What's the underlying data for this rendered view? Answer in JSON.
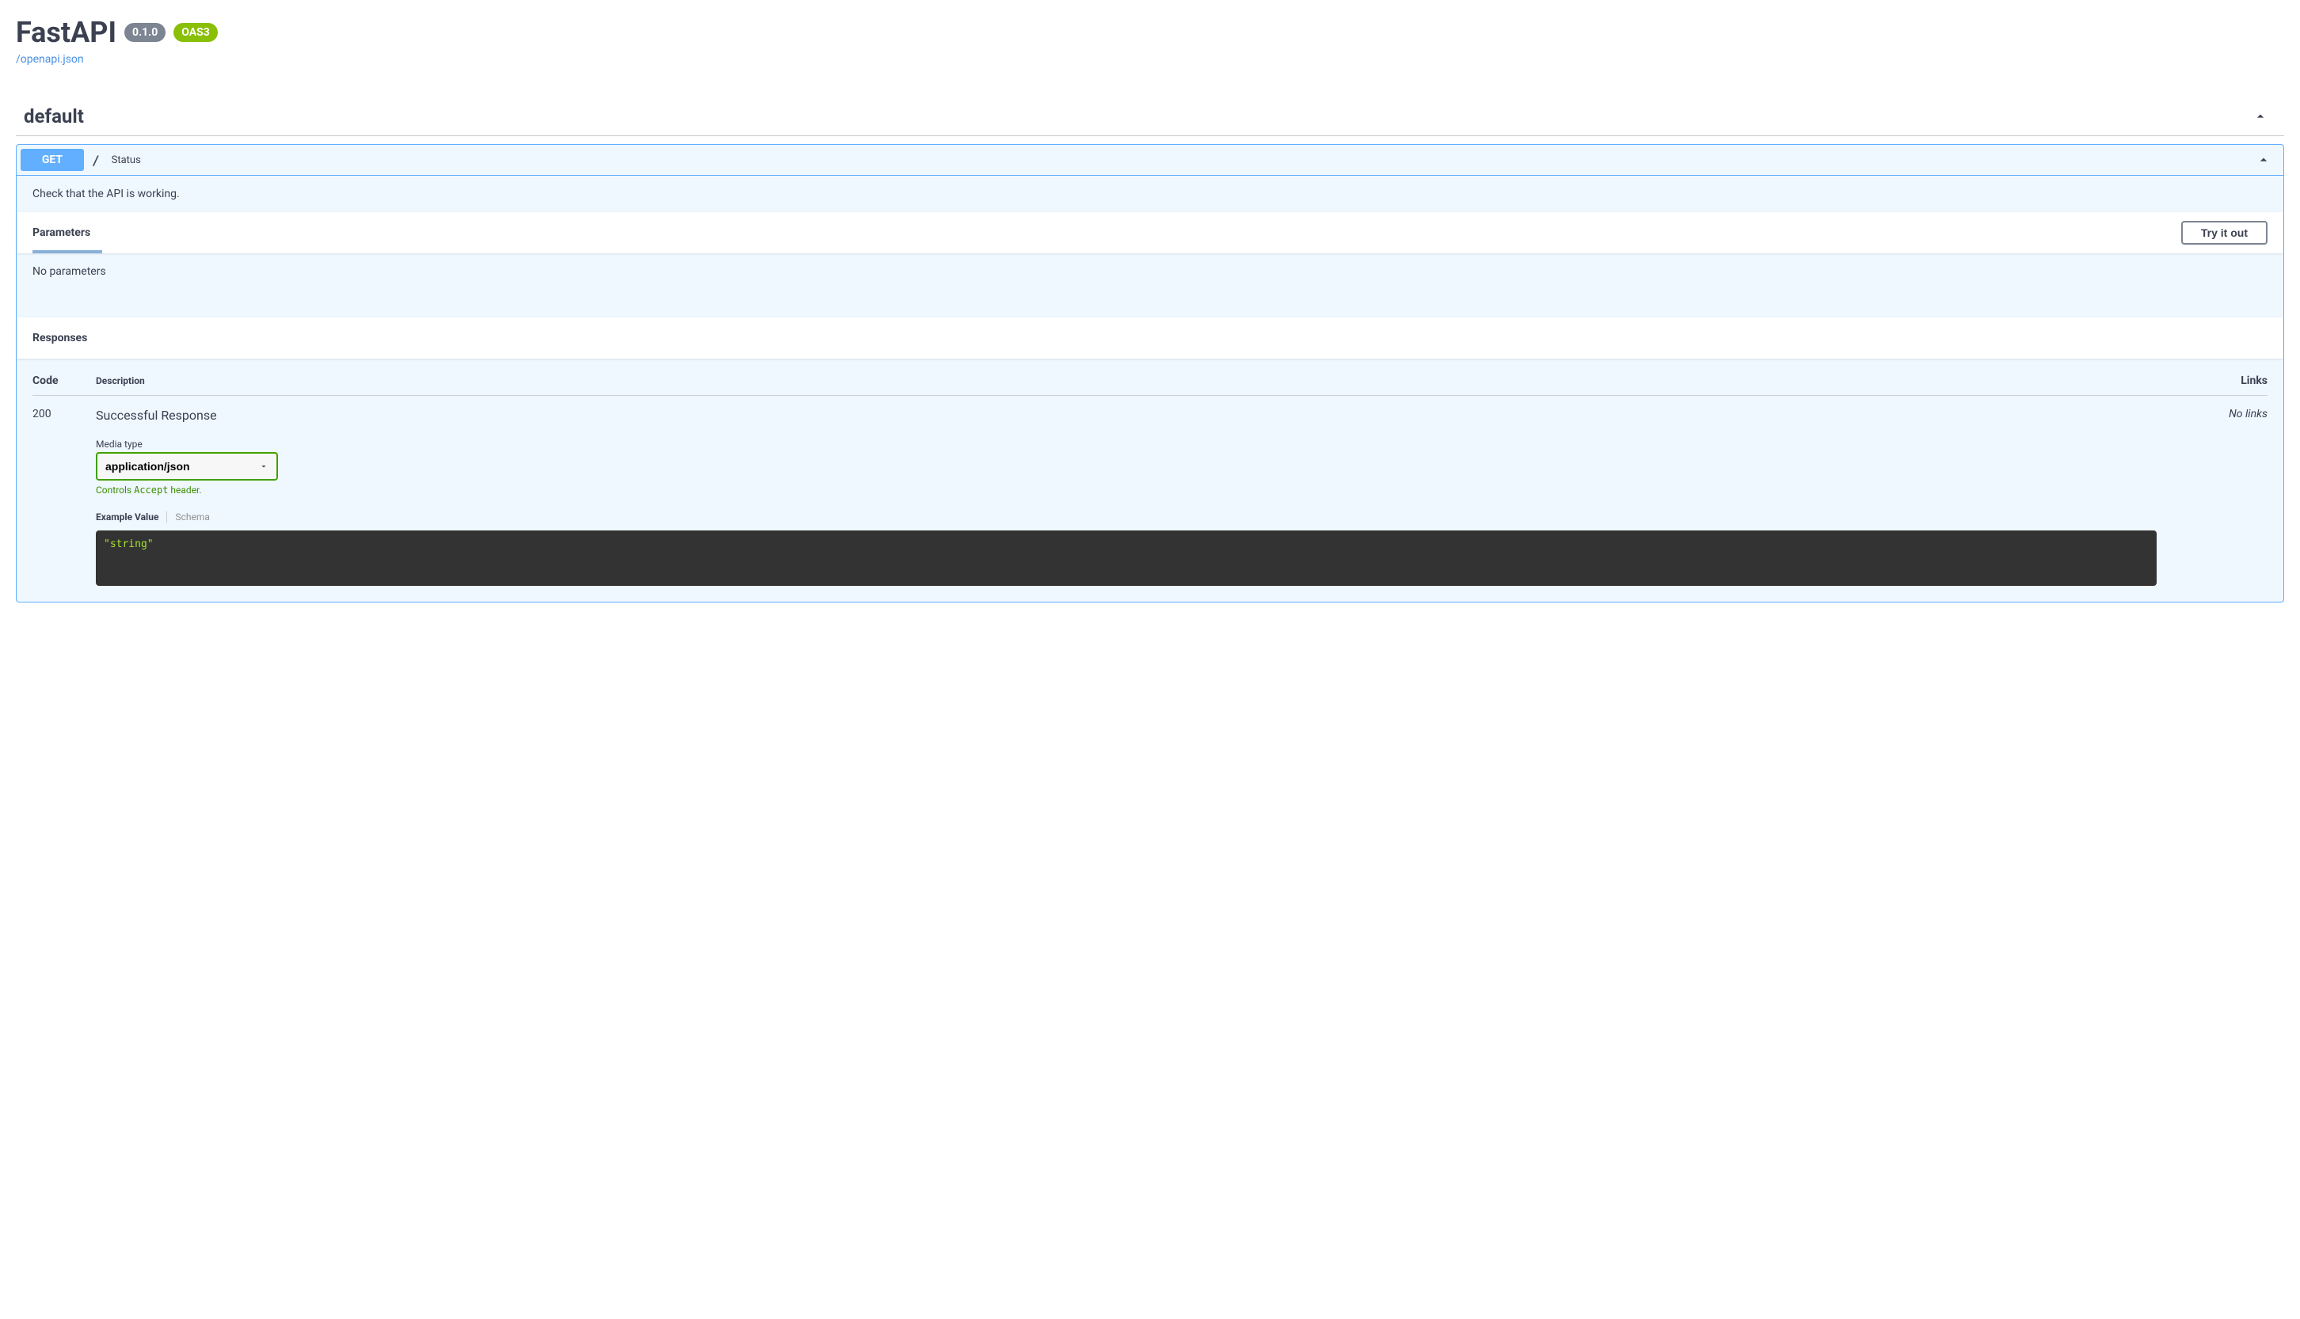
{
  "header": {
    "title": "FastAPI",
    "version": "0.1.0",
    "oas": "OAS3",
    "spec_link": "/openapi.json"
  },
  "tag": {
    "name": "default"
  },
  "operation": {
    "method": "GET",
    "path": "/",
    "summary": "Status",
    "description": "Check that the API is working."
  },
  "parameters": {
    "header": "Parameters",
    "try_button": "Try it out",
    "no_params": "No parameters"
  },
  "responses": {
    "header": "Responses",
    "columns": {
      "code": "Code",
      "description": "Description",
      "links": "Links"
    },
    "row": {
      "code": "200",
      "description": "Successful Response",
      "no_links": "No links"
    },
    "media_type": {
      "label": "Media type",
      "selected": "application/json",
      "hint_pre": "Controls ",
      "hint_code": "Accept",
      "hint_post": " header."
    },
    "tabs": {
      "example": "Example Value",
      "schema": "Schema"
    },
    "example_body": "\"string\""
  }
}
